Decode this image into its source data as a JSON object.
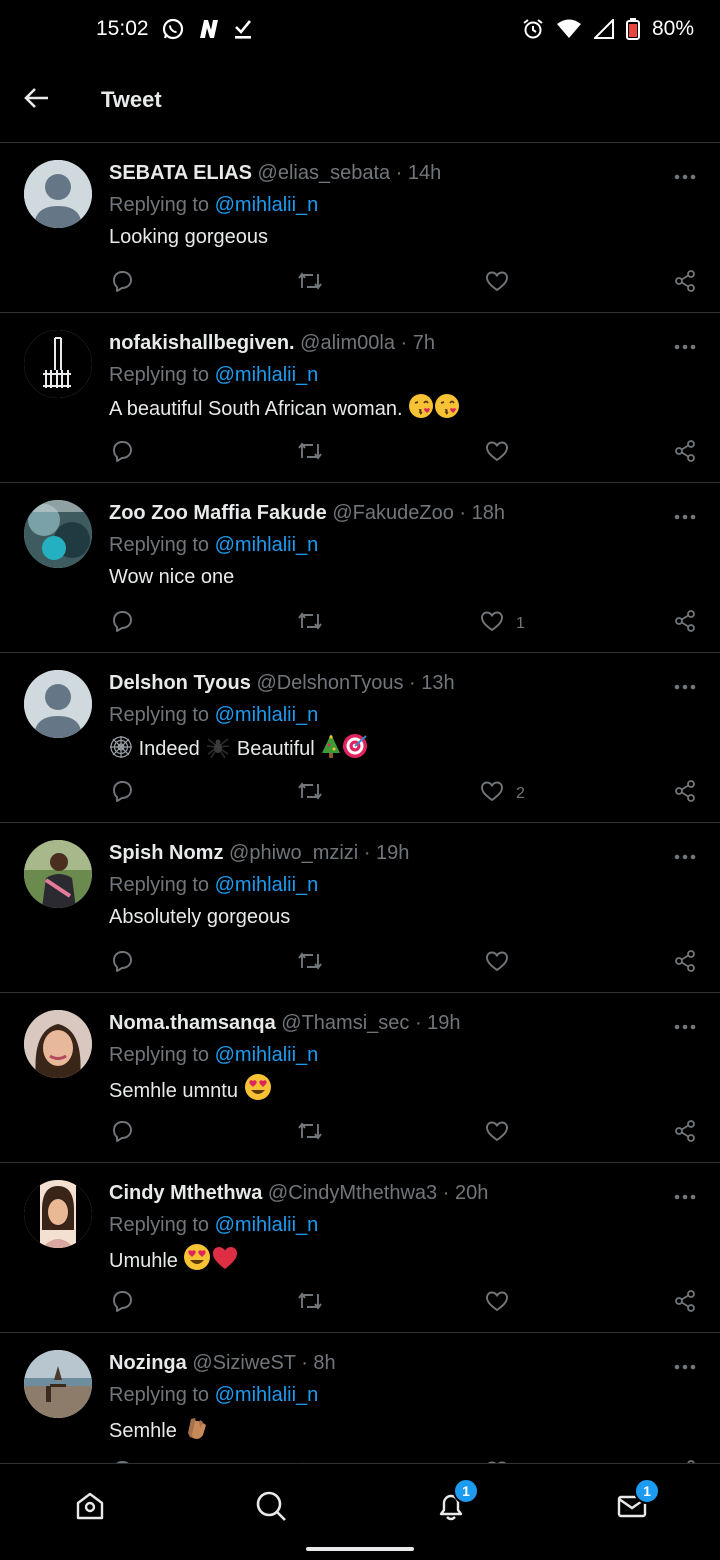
{
  "status_bar": {
    "time": "15:02",
    "battery": "80%"
  },
  "header": {
    "title": "Tweet"
  },
  "reply_prefix": "Replying to",
  "tweets": [
    {
      "name": "SEBATA ELIAS",
      "handle": "@elias_sebata",
      "time": "· 14h",
      "mention": "@mihlalii_n",
      "text": "Looking gorgeous",
      "likes": "",
      "emojis": []
    },
    {
      "name": "nofakishallbegiven.",
      "handle": "@alim00la",
      "time": "· 7h",
      "mention": "@mihlalii_n",
      "text": "A beautiful South African woman.",
      "likes": "",
      "emojis": [
        "kiss-face-emoji",
        "kiss-face-emoji"
      ]
    },
    {
      "name": "Zoo Zoo Maffia Fakude",
      "handle": "@FakudeZoo",
      "time": "· 18h",
      "mention": "@mihlalii_n",
      "text": "Wow nice one",
      "likes": "1",
      "emojis": []
    },
    {
      "name": "Delshon Tyous",
      "handle": "@DelshonTyous",
      "time": "· 13h",
      "mention": "@mihlalii_n",
      "text_parts": [
        "Indeed",
        "Beautiful"
      ],
      "likes": "2",
      "emojis": [
        "spider-web-emoji",
        "spider-emoji",
        "christmas-tree-emoji",
        "bullseye-emoji"
      ]
    },
    {
      "name": "Spish Nomz",
      "handle": "@phiwo_mzizi",
      "time": "· 19h",
      "mention": "@mihlalii_n",
      "text": "Absolutely gorgeous",
      "likes": "",
      "emojis": []
    },
    {
      "name": "Noma.thamsanqa",
      "handle": "@Thamsi_sec",
      "time": "· 19h",
      "mention": "@mihlalii_n",
      "text": "Semhle umntu",
      "likes": "",
      "emojis": [
        "heart-eyes-emoji"
      ]
    },
    {
      "name": "Cindy Mthethwa",
      "handle": "@CindyMthethwa3",
      "time": "· 20h",
      "mention": "@mihlalii_n",
      "text": "Umuhle",
      "likes": "",
      "emojis": [
        "heart-eyes-emoji",
        "red-heart-emoji"
      ]
    },
    {
      "name": "Nozinga",
      "handle": "@SiziweST",
      "time": "· 8h",
      "mention": "@mihlalii_n",
      "text": "Semhle",
      "likes": "",
      "emojis": [
        "clapping-hands-emoji"
      ]
    }
  ],
  "bottom_nav": {
    "notifications_badge": "1",
    "messages_badge": "1"
  },
  "colors": {
    "accent": "#1d9bf0",
    "background": "#000000",
    "divider": "#2f3336",
    "muted": "#71767b"
  }
}
